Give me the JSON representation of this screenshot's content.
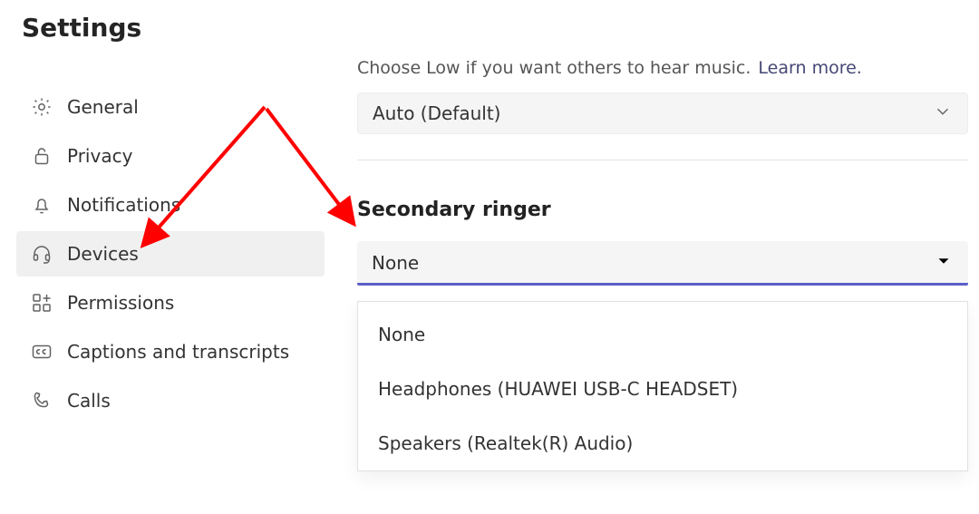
{
  "sidebar": {
    "title": "Settings",
    "items": [
      {
        "label": "General"
      },
      {
        "label": "Privacy"
      },
      {
        "label": "Notifications"
      },
      {
        "label": "Devices"
      },
      {
        "label": "Permissions"
      },
      {
        "label": "Captions and transcripts"
      },
      {
        "label": "Calls"
      }
    ]
  },
  "main": {
    "helper_text": "Choose Low if you want others to hear music.",
    "learn_more": "Learn more.",
    "first_select_value": "Auto (Default)",
    "ringer_title": "Secondary ringer",
    "ringer_value": "None",
    "ringer_options": [
      "None",
      "Headphones (HUAWEI USB-C HEADSET)",
      "Speakers (Realtek(R) Audio)"
    ]
  },
  "colors": {
    "accent": "#5b5fc7",
    "arrow": "#ff0000"
  }
}
